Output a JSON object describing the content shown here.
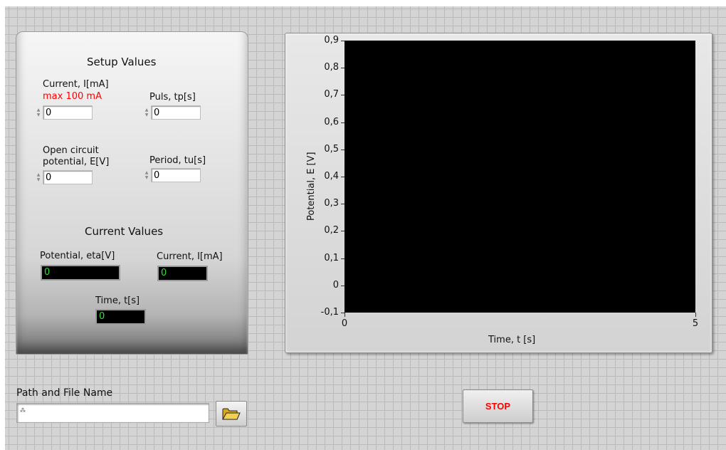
{
  "setup": {
    "title": "Setup Values",
    "current_label": "Current, I[mA]",
    "current_max_note": "max 100 mA",
    "current_value": "0",
    "puls_label": "Puls, tp[s]",
    "puls_value": "0",
    "ocp_label_line1": "Open circuit",
    "ocp_label_line2": "potential, E[V]",
    "ocp_value": "0",
    "period_label": "Period, tu[s]",
    "period_value": "0"
  },
  "current_values": {
    "title": "Current Values",
    "potential_label": "Potential, eta[V]",
    "potential_value": "0",
    "current_label": "Current, I[mA]",
    "current_value": "0",
    "time_label": "Time, t[s]",
    "time_value": "0"
  },
  "file": {
    "path_label": "Path and File Name",
    "path_value": ""
  },
  "stop_label": "STOP",
  "colors": {
    "note_red": "#ff0000",
    "indicator_text": "#33dd33",
    "plot_background": "#000000"
  },
  "icons": {
    "browse": "folder-open-icon",
    "path": "path-icon"
  },
  "chart_data": {
    "type": "line",
    "xlabel": "Time, t [s]",
    "ylabel": "Potential, E [V]",
    "xlim": [
      0,
      5
    ],
    "ylim": [
      -0.1,
      0.9
    ],
    "x_ticks": [
      "0",
      "5"
    ],
    "y_ticks": [
      "0,9",
      "0,8",
      "0,7",
      "0,6",
      "0,5",
      "0,4",
      "0,3",
      "0,2",
      "0,1",
      "0",
      "-0,1"
    ],
    "series": []
  }
}
